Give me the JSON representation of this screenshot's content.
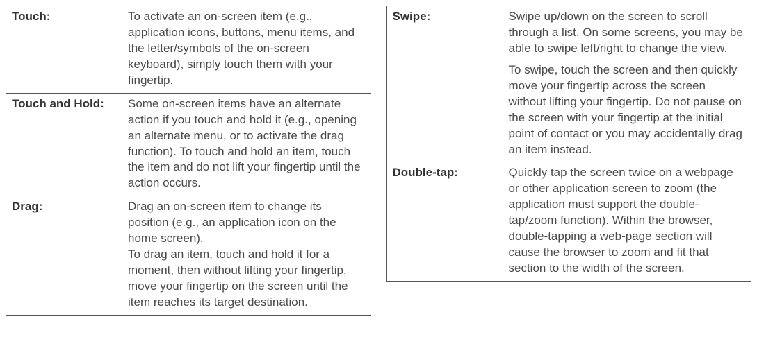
{
  "left": [
    {
      "label": "Touch:",
      "paras": [
        "To activate an on-screen item (e.g., application icons, buttons, menu items,  and the letter/symbols of the on-screen keyboard), simply touch them with your fingertip."
      ]
    },
    {
      "label": "Touch and Hold:",
      "paras": [
        "Some on-screen items have an alternate action if you touch and hold it (e.g., opening an alternate menu, or to activate the drag function). To touch and hold an item, touch the item and do not lift your fingertip until the action occurs."
      ]
    },
    {
      "label": "Drag:",
      "paras": [
        "Drag an on-screen item to change its position (e.g., an application icon on the home screen).\nTo drag an item, touch and hold it for a moment, then without lifting your fingertip, move your fingertip on the screen until the item reaches its target destination."
      ]
    }
  ],
  "right": [
    {
      "label": "Swipe:",
      "paras": [
        "Swipe up/down on the screen to scroll through a list. On some screens, you may be able to swipe left/right to change the view.",
        "To swipe, touch the screen and then quickly move your fingertip across the screen without lifting your fingertip. Do not pause on the screen with your fingertip at the initial point of contact or you may accidentally drag an item instead."
      ]
    },
    {
      "label": "Double-tap:",
      "paras": [
        "Quickly tap the screen twice on a webpage or other application screen to zoom (the application must support the double-tap/zoom function). Within the browser, double-tapping a web-page section will cause the browser to zoom and fit that section to the width of the screen."
      ]
    }
  ]
}
